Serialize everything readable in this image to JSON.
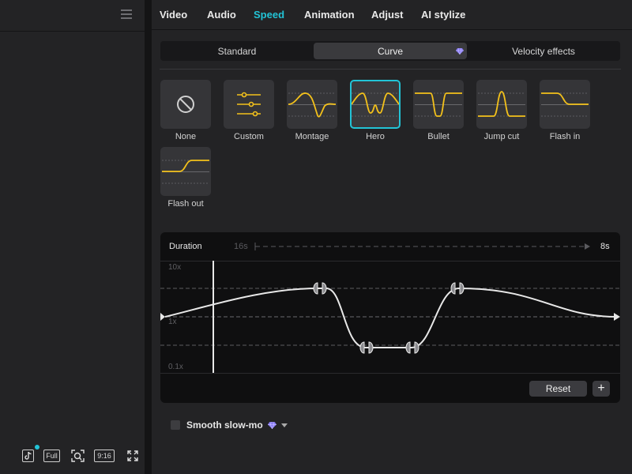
{
  "left_panel": {
    "menu_icon": "hamburger-icon",
    "bottom_bar": {
      "tiktok_icon": "tiktok-icon",
      "full_label": "Full",
      "screenshot_icon": "focus-icon",
      "ratio_label": "9:16",
      "fullscreen_icon": "expand-icon",
      "notify_color": "#22c3d6"
    }
  },
  "tabs": [
    {
      "label": "Video"
    },
    {
      "label": "Audio"
    },
    {
      "label": "Speed"
    },
    {
      "label": "Animation"
    },
    {
      "label": "Adjust"
    },
    {
      "label": "AI stylize"
    }
  ],
  "active_tab": "Speed",
  "speed_modes": [
    {
      "label": "Standard"
    },
    {
      "label": "Curve"
    },
    {
      "label": "Velocity effects"
    }
  ],
  "active_mode": "Curve",
  "presets": [
    {
      "label": "None",
      "icon": "no-entry-icon"
    },
    {
      "label": "Custom",
      "icon": "sliders-icon"
    },
    {
      "label": "Montage",
      "icon": "curve-montage-icon"
    },
    {
      "label": "Hero",
      "icon": "curve-hero-icon"
    },
    {
      "label": "Bullet",
      "icon": "curve-bullet-icon"
    },
    {
      "label": "Jump cut",
      "icon": "curve-jump-cut-icon"
    },
    {
      "label": "Flash in",
      "icon": "curve-flash-in-icon"
    },
    {
      "label": "Flash out",
      "icon": "curve-flash-out-icon"
    }
  ],
  "selected_preset": "Hero",
  "curve_editor": {
    "duration_label": "Duration",
    "original_duration": "16s",
    "new_duration": "8s",
    "axis_labels": [
      "10x",
      "1x",
      "0.1x"
    ],
    "reset_label": "Reset",
    "add_label": "+"
  },
  "smooth_slowmo": {
    "label": "Smooth slow-mo",
    "checked": false
  },
  "colors": {
    "accent": "#22c3d6",
    "curve_yellow": "#f3c11b",
    "premium_gem": "#8a7cf5"
  }
}
